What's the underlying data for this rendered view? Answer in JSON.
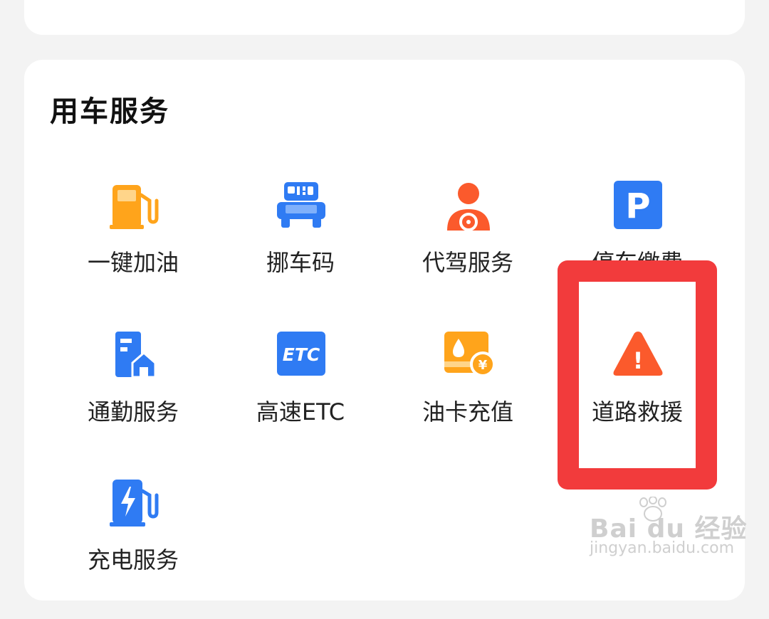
{
  "section": {
    "title": "用车服务"
  },
  "services": [
    {
      "label": "一键加油",
      "icon": "fuel-pump-icon"
    },
    {
      "label": "挪车码",
      "icon": "car-code-icon"
    },
    {
      "label": "代驾服务",
      "icon": "driver-icon"
    },
    {
      "label": "停车缴费",
      "icon": "parking-icon"
    },
    {
      "label": "通勤服务",
      "icon": "commute-building-icon"
    },
    {
      "label": "高速ETC",
      "icon": "etc-icon"
    },
    {
      "label": "油卡充值",
      "icon": "fuel-card-icon"
    },
    {
      "label": "道路救援",
      "icon": "warning-triangle-icon"
    },
    {
      "label": "充电服务",
      "icon": "ev-charger-icon"
    }
  ],
  "icons": {
    "etc_text": "ETC",
    "parking_letter": "P",
    "yen_symbol": "¥",
    "warning_mark": "!"
  },
  "watermark": {
    "brand": "Bai du 经验",
    "url": "jingyan.baidu.com"
  },
  "colors": {
    "orange": "#ffa41b",
    "blue": "#2f7bf3",
    "red_orange": "#fb5a2c",
    "highlight_red": "#f23b3c"
  }
}
